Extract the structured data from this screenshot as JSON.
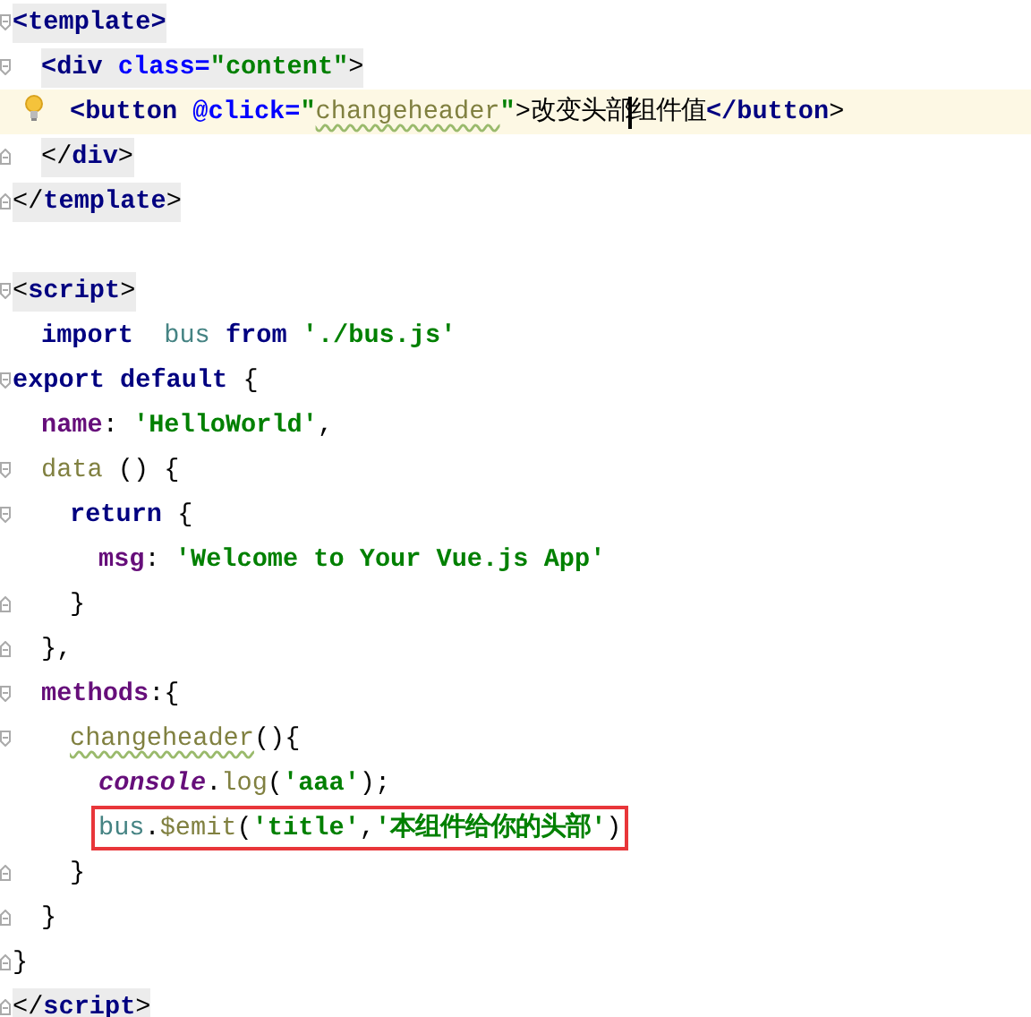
{
  "editor": {
    "lines": [
      {
        "fold_open": true,
        "tokens": [
          {
            "kind": "tag",
            "text": "<template>",
            "marked": true
          }
        ],
        "children": [
          {
            "fold_open": true,
            "tokens": [
              {
                "kind": "tag",
                "text": "<div",
                "marked": true
              },
              {
                "kind": "attr",
                "text": " class=",
                "marked": true
              },
              {
                "kind": "str",
                "text": "\"content\"",
                "marked": true
              },
              {
                "kind": "punct",
                "text": ">",
                "marked": true
              }
            ],
            "children": [
              {
                "current": true,
                "bulb": true,
                "tokens": [
                  {
                    "kind": "tag",
                    "text": "<button"
                  },
                  {
                    "kind": "attr",
                    "text": " @click="
                  },
                  {
                    "kind": "str",
                    "text": "\""
                  },
                  {
                    "kind": "ident",
                    "text": "changeheader",
                    "warning": true
                  },
                  {
                    "kind": "str",
                    "text": "\""
                  },
                  {
                    "kind": "punct",
                    "text": ">"
                  },
                  {
                    "kind": "plain",
                    "text": "改变头部"
                  },
                  {
                    "kind": "caret"
                  },
                  {
                    "kind": "plain",
                    "text": "组件值"
                  },
                  {
                    "kind": "tag",
                    "text": "</button"
                  },
                  {
                    "kind": "punct",
                    "text": ">"
                  }
                ]
              }
            ]
          },
          {
            "fold_close": true,
            "tokens": [
              {
                "kind": "punct",
                "text": "</",
                "marked": true
              },
              {
                "kind": "tag",
                "text": "div",
                "marked": true
              },
              {
                "kind": "punct",
                "text": ">",
                "marked": true
              }
            ]
          }
        ]
      },
      {
        "fold_close": true,
        "tokens": [
          {
            "kind": "punct",
            "text": "</",
            "marked": true
          },
          {
            "kind": "tag",
            "text": "template",
            "marked": true
          },
          {
            "kind": "punct",
            "text": ">",
            "marked": true
          }
        ]
      },
      {
        "fold_open": true,
        "space_above": true,
        "tokens": [
          {
            "kind": "punct",
            "text": "<",
            "marked": true
          },
          {
            "kind": "tag",
            "text": "script",
            "marked": true
          },
          {
            "kind": "punct",
            "text": ">",
            "marked": true
          }
        ],
        "children": [
          {
            "tokens": [
              {
                "kind": "keyword",
                "text": "import"
              },
              {
                "kind": "var",
                "text": "  bus"
              },
              {
                "kind": "keyword",
                "text": " from"
              },
              {
                "kind": "str",
                "text": " './bus.js'"
              }
            ]
          }
        ]
      },
      {
        "fold_open": true,
        "tokens": [
          {
            "kind": "keyword",
            "text": "export default"
          },
          {
            "kind": "punct",
            "text": " {"
          }
        ],
        "children": [
          {
            "tokens": [
              {
                "kind": "prop",
                "text": "name"
              },
              {
                "kind": "punct",
                "text": ": "
              },
              {
                "kind": "str",
                "text": "'HelloWorld'"
              },
              {
                "kind": "punct",
                "text": ","
              }
            ]
          },
          {
            "fold_open": true,
            "tokens": [
              {
                "kind": "ident",
                "text": "data"
              },
              {
                "kind": "punct",
                "text": " () {"
              }
            ],
            "children": [
              {
                "fold_open": true,
                "tokens": [
                  {
                    "kind": "keyword",
                    "text": "return"
                  },
                  {
                    "kind": "punct",
                    "text": " {"
                  }
                ],
                "children": [
                  {
                    "tokens": [
                      {
                        "kind": "prop",
                        "text": "msg"
                      },
                      {
                        "kind": "punct",
                        "text": ": "
                      },
                      {
                        "kind": "str",
                        "text": "'Welcome to Your Vue.js App'"
                      }
                    ]
                  }
                ]
              },
              {
                "fold_close": true,
                "tokens": [
                  {
                    "kind": "punct",
                    "text": "}"
                  }
                ]
              }
            ]
          },
          {
            "fold_close": true,
            "tokens": [
              {
                "kind": "punct",
                "text": "},"
              }
            ]
          },
          {
            "fold_open": true,
            "tokens": [
              {
                "kind": "prop",
                "text": "methods"
              },
              {
                "kind": "punct",
                "text": ":{"
              }
            ],
            "children": [
              {
                "fold_open": true,
                "tokens": [
                  {
                    "kind": "ident",
                    "text": "changeheader",
                    "warning": true
                  },
                  {
                    "kind": "punct",
                    "text": "(){"
                  }
                ],
                "children": [
                  {
                    "tokens": [
                      {
                        "kind": "italic",
                        "text": "console"
                      },
                      {
                        "kind": "punct",
                        "text": "."
                      },
                      {
                        "kind": "ident",
                        "text": "log"
                      },
                      {
                        "kind": "punct",
                        "text": "("
                      },
                      {
                        "kind": "str",
                        "text": "'aaa'"
                      },
                      {
                        "kind": "punct",
                        "text": ");"
                      }
                    ]
                  },
                  {
                    "boxed": true,
                    "tokens": [
                      {
                        "kind": "var",
                        "text": "bus"
                      },
                      {
                        "kind": "punct",
                        "text": "."
                      },
                      {
                        "kind": "ident",
                        "text": "$emit"
                      },
                      {
                        "kind": "punct",
                        "text": "("
                      },
                      {
                        "kind": "str",
                        "text": "'title'"
                      },
                      {
                        "kind": "punct",
                        "text": ","
                      },
                      {
                        "kind": "str",
                        "text": "'本组件给你的头部'"
                      },
                      {
                        "kind": "punct",
                        "text": ")"
                      }
                    ]
                  }
                ]
              },
              {
                "fold_close": true,
                "tokens": [
                  {
                    "kind": "punct",
                    "text": "}"
                  }
                ]
              }
            ]
          },
          {
            "fold_close": true,
            "tokens": [
              {
                "kind": "punct",
                "text": "}"
              }
            ]
          }
        ]
      },
      {
        "fold_close": true,
        "tokens": [
          {
            "kind": "punct",
            "text": "}"
          }
        ]
      },
      {
        "fold_close": true,
        "tokens": [
          {
            "kind": "punct",
            "text": "</",
            "marked": true
          },
          {
            "kind": "tag",
            "text": "script",
            "marked": true
          },
          {
            "kind": "punct",
            "text": ">",
            "marked": true
          }
        ]
      }
    ]
  }
}
